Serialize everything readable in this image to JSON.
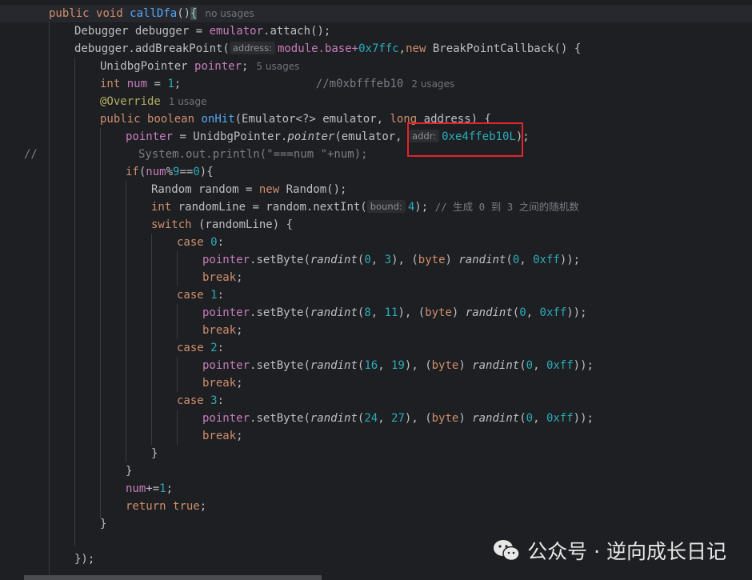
{
  "code": {
    "line_top": {
      "text": ""
    },
    "method_decl": {
      "kw1": "public",
      "kw2": "void",
      "name": "callDfa",
      "paren": "()",
      "brace": "{",
      "usage": "no usages"
    },
    "debugger_decl": {
      "type": "Debugger debugger = ",
      "field": "emulator",
      "rest": ".attach();"
    },
    "breakpoint": {
      "pre": "debugger.addBreakPoint(",
      "hint": "address:",
      "field": "module",
      "mid": ".base+",
      "num": "0x7ffc",
      "comma": ",",
      "kw": "new",
      "post": " BreakPointCallback() {"
    },
    "pointer_decl": {
      "type": "UnidbgPointer ",
      "field": "pointer",
      "semi": ";",
      "usage": "5 usages"
    },
    "num_decl": {
      "kw": "int",
      "field": "num",
      "eq": " = ",
      "val": "1",
      "semi": ";",
      "comment": "//m0xbfffeb10",
      "usage": "2 usages"
    },
    "override": {
      "anno": "@Override",
      "usage": "1 usage"
    },
    "onhit": {
      "kw1": "public",
      "kw2": "boolean",
      "name": "onHit",
      "params": "(Emulator<?> emulator, ",
      "kw3": "long",
      "rest": " address) {"
    },
    "pointer_assign": {
      "field": "pointer",
      "mid": " = UnidbgPointer.",
      "method": "pointer",
      "args": "(emulator, ",
      "hint": "addr:",
      "num": "0xe4ffeb10L",
      "post": ");"
    },
    "comment_prefix": "//",
    "println": "System.out.println(\"===num \"+num);",
    "if_line": {
      "kw": "if",
      "open": "(",
      "field": "num",
      "mod": "%",
      "n9": "9",
      "eq": "==",
      "n0": "0",
      "close": "){"
    },
    "random_decl": {
      "pre": "Random random = ",
      "kw": "new",
      "post": " Random();"
    },
    "randline_decl": {
      "kw": "int",
      "mid": " randomLine = random.nextInt(",
      "hint": "bound:",
      "num": "4",
      "post": "); ",
      "comment": "// 生成 0 到 3 之间的随机数"
    },
    "switch_line": {
      "kw": "switch",
      "post": " (randomLine) {"
    },
    "cases": [
      {
        "label": "0",
        "a": "0",
        "b": "3"
      },
      {
        "label": "1",
        "a": "8",
        "b": "11"
      },
      {
        "label": "2",
        "a": "16",
        "b": "19"
      },
      {
        "label": "3",
        "a": "24",
        "b": "27"
      }
    ],
    "case_kw": "case",
    "colon": ":",
    "setbyte_field": "pointer",
    "setbyte_method": ".setByte(",
    "randint": "randint",
    "byte_kw": "byte",
    "hex": "0xff",
    "break_kw": "break",
    "close_brace": "}",
    "num_inc": {
      "field": "num",
      "op": "+=",
      "val": "1",
      "semi": ";"
    },
    "return_line": {
      "kw1": "return",
      "kw2": "true",
      "semi": ";"
    },
    "end_line": "});"
  },
  "watermark": {
    "text": "公众号 · 逆向成长日记"
  },
  "colors": {
    "highlight_box": "#e0262a",
    "background": "#1e1f22"
  }
}
